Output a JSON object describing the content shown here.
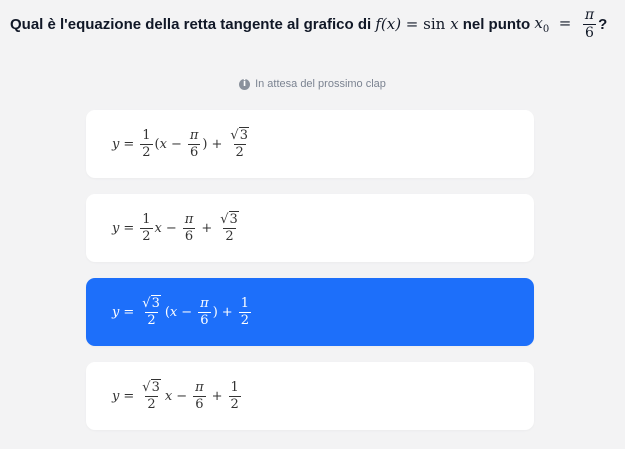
{
  "question": {
    "text": "Qual è l'equazione della retta tangente al grafico di",
    "function": "f(x) = sin x",
    "point_text": "nel punto",
    "point_var": "x",
    "point_sub": "0",
    "point_num": "π",
    "point_den": "6",
    "qmark": "?"
  },
  "status": {
    "icon": "info-icon",
    "text": "In attesa del prossimo clap"
  },
  "options": [
    {
      "id": "option-1",
      "selected": false
    },
    {
      "id": "option-2",
      "selected": false
    },
    {
      "id": "option-3",
      "selected": true
    },
    {
      "id": "option-4",
      "selected": false
    }
  ],
  "math": {
    "y": "y",
    "eq": "=",
    "x": "x",
    "one": "1",
    "two": "2",
    "pi": "π",
    "six": "6",
    "three": "3",
    "sqrt": "√",
    "lp": "(",
    "rp": ")",
    "minus": "−",
    "plus": "+"
  },
  "colors": {
    "background": "#f3f3f4",
    "card": "#ffffff",
    "selected": "#1d6ffa",
    "status_text": "#7b8391"
  }
}
